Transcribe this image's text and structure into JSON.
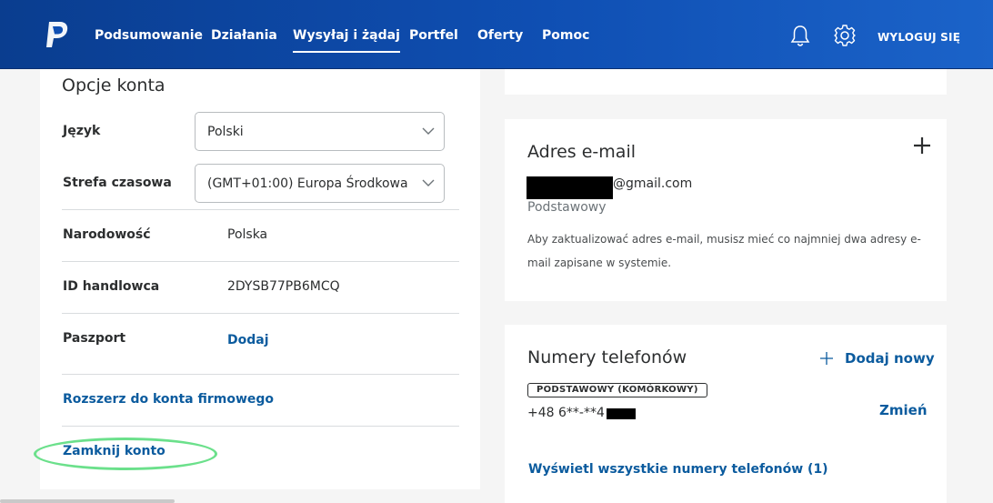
{
  "header": {
    "nav": [
      "Podsumowanie",
      "Działania",
      "Wysyłaj i żądaj",
      "Portfel",
      "Oferty",
      "Pomoc"
    ],
    "active_index": 2,
    "logout": "WYLOGUJ SIĘ",
    "icons": [
      "paypal-logo",
      "bell-icon",
      "gear-icon"
    ],
    "colors": {
      "header": "#0f4fb3",
      "link": "#0b5b9e",
      "highlight": "#6be08b"
    }
  },
  "account_options": {
    "title": "Opcje konta",
    "language_label": "Język",
    "language_value": "Polski",
    "timezone_label": "Strefa czasowa",
    "timezone_value": "(GMT+01:00) Europa Środkowa",
    "nationality_label": "Narodowość",
    "nationality_value": "Polska",
    "merchant_id_label": "ID handlowca",
    "merchant_id_value": "2DYSB77PB6MCQ",
    "passport_label": "Paszport",
    "passport_add": "Dodaj",
    "upgrade_link": "Rozszerz do konta firmowego",
    "close_account_link": "Zamknij konto"
  },
  "email": {
    "title": "Adres e-mail",
    "address_suffix": "@gmail.com",
    "primary": "Podstawowy",
    "note_line1": "Aby zaktualizować adres e-mail, musisz mieć co najmniej dwa adresy e-",
    "note_line2": "mail zapisane w systemie."
  },
  "phones": {
    "title": "Numery telefonów",
    "add_new": "Dodaj nowy",
    "badge": "PODSTAWOWY (KOMÓRKOWY)",
    "number": "+48 6**-**4",
    "change": "Zmień",
    "view_all": "Wyświetl wszystkie numery telefonów (1)"
  }
}
